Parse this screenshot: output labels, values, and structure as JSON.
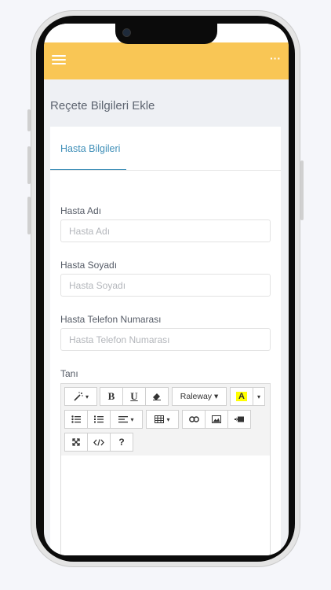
{
  "header": {
    "more_label": "···"
  },
  "page": {
    "title": "Reçete Bilgileri Ekle"
  },
  "tabs": [
    {
      "label": "Hasta Bilgileri"
    }
  ],
  "form": {
    "fields": [
      {
        "label": "Hasta Adı",
        "placeholder": "Hasta Adı"
      },
      {
        "label": "Hasta Soyadı",
        "placeholder": "Hasta Soyadı"
      },
      {
        "label": "Hasta Telefon Numarası",
        "placeholder": "Hasta Telefon Numarası"
      }
    ],
    "editor_label": "Tanı"
  },
  "editor": {
    "toolbar": {
      "bold": "B",
      "underline": "U",
      "font_name": "Raleway ▾",
      "color_letter": "A",
      "help": "?"
    },
    "icons": [
      "magic-icon",
      "bold-icon",
      "underline-icon",
      "eraser-icon",
      "font-icon",
      "color-icon",
      "unordered-list-icon",
      "ordered-list-icon",
      "paragraph-icon",
      "table-icon",
      "link-icon",
      "picture-icon",
      "video-icon",
      "fullscreen-icon",
      "code-view-icon",
      "help-icon"
    ]
  },
  "colors": {
    "accent": "#f9c655",
    "tab": "#3f8fb8",
    "highlight": "#ffff00"
  }
}
